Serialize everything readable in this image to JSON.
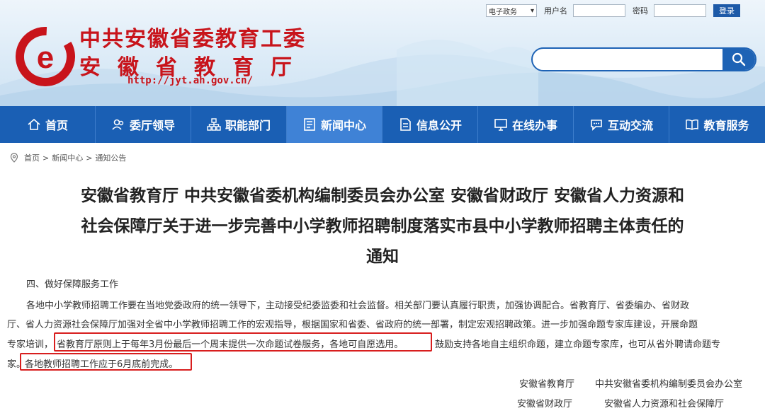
{
  "header": {
    "title_line1": "中共安徽省委教育工委",
    "title_line2": "安徽省教育厅",
    "url": "http://jyt.ah.gov.cn/",
    "login": {
      "select_value": "电子政务",
      "username_label": "用户名",
      "password_label": "密码",
      "login_button": "登录"
    },
    "search": {
      "placeholder": "",
      "icon": "search-icon"
    }
  },
  "nav": {
    "items": [
      {
        "label": "首页",
        "icon": "home-icon"
      },
      {
        "label": "委厅领导",
        "icon": "leaders-icon"
      },
      {
        "label": "职能部门",
        "icon": "org-chart-icon"
      },
      {
        "label": "新闻中心",
        "icon": "news-icon"
      },
      {
        "label": "信息公开",
        "icon": "document-icon"
      },
      {
        "label": "在线办事",
        "icon": "monitor-icon"
      },
      {
        "label": "互动交流",
        "icon": "chat-icon"
      },
      {
        "label": "教育服务",
        "icon": "book-icon"
      }
    ],
    "active_index": 3
  },
  "breadcrumb": {
    "items": [
      "首页",
      "新闻中心",
      "通知公告"
    ],
    "separator": ">"
  },
  "article": {
    "title_lines": [
      "安徽省教育厅 中共安徽省委机构编制委员会办公室 安徽省财政厅 安徽省人力资源和",
      "社会保障厅关于进一步完善中小学教师招聘制度落实市县中小学教师招聘主体责任的",
      "通知"
    ],
    "section_heading": "四、做好保障服务工作",
    "lines": [
      "各地中小学教师招聘工作要在当地党委政府的统一领导下，主动接受纪委监委和社会监督。相关部门要认真履行职责，加强协调配合。省教育厅、省委编办、省财政",
      "厅、省人力资源社会保障厅加强对全省中小学教师招聘工作的宏观指导，根据国家和省委、省政府的统一部署，制定宏观招聘政策。进一步加强命题专家库建设，开展命题",
      "专家培训，",
      "省教育厅原则上于每年3月份最后一个周末提供一次命题试卷服务，各地可自愿选用。",
      "鼓励支持各地自主组织命题，建立命题专家库，也可从省外聘请命题专",
      "家。",
      "各地教师招聘工作应于6月底前完成。"
    ],
    "signatures": [
      [
        "安徽省教育厅",
        "中共安徽省委机构编制委员会办公室"
      ],
      [
        "安徽省财政厅",
        "安徽省人力资源和社会保障厅"
      ]
    ]
  },
  "colors": {
    "brand_red": "#c8141b",
    "nav_blue": "#1a5fb4",
    "nav_active": "#3f82d6",
    "highlight_red": "#d81e1e"
  }
}
